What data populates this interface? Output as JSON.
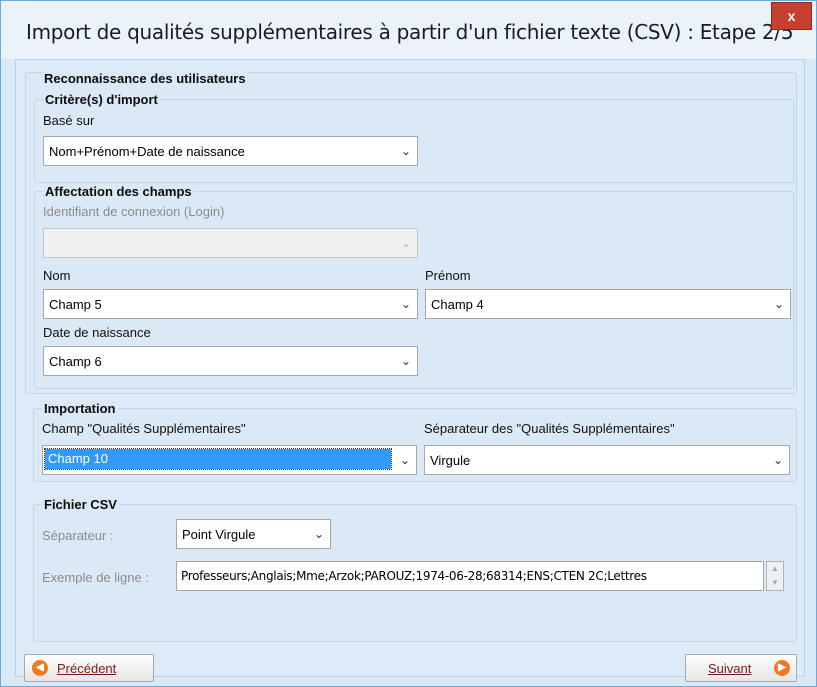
{
  "window": {
    "title": "Import de qualités supplémentaires à partir d'un fichier texte (CSV) : Etape 2/5",
    "close_glyph": "x"
  },
  "recognition": {
    "section_title": "Reconnaissance des utilisateurs",
    "criteria": {
      "title": "Critère(s) d'import",
      "based_on_label": "Basé sur",
      "based_on_value": "Nom+Prénom+Date de naissance"
    },
    "fields": {
      "title": "Affectation des champs",
      "login_label": "Identifiant de connexion (Login)",
      "login_value": "",
      "nom_label": "Nom",
      "nom_value": "Champ 5",
      "prenom_label": "Prénom",
      "prenom_value": "Champ 4",
      "dob_label": "Date de naissance",
      "dob_value": "Champ 6"
    }
  },
  "importation": {
    "title": "Importation",
    "field_label": "Champ \"Qualités Supplémentaires\"",
    "field_value": "Champ 10",
    "separator_label": "Séparateur des \"Qualités Supplémentaires\"",
    "separator_value": "Virgule"
  },
  "csv": {
    "title": "Fichier CSV",
    "separator_label": "Séparateur :",
    "separator_value": "Point Virgule",
    "example_label": "Exemple de ligne :",
    "example_value": "Professeurs;Anglais;Mme;Arzok;PAROUZ;1974-06-28;68314;ENS;CTEN 2C;Lettres"
  },
  "footer": {
    "prev_label": "Précédent",
    "next_label": "Suivant",
    "prev_icon": "arrow-left-circle-icon",
    "next_icon": "arrow-right-circle-icon"
  },
  "icons": {
    "dropdown": "chevron-down-icon",
    "spin": "spin-arrows-icon"
  },
  "colors": {
    "accent": "#3399ff",
    "nav_button_icon": "#f07a24",
    "close_button": "#c7402f",
    "dialog_background": "#dcebf7"
  }
}
